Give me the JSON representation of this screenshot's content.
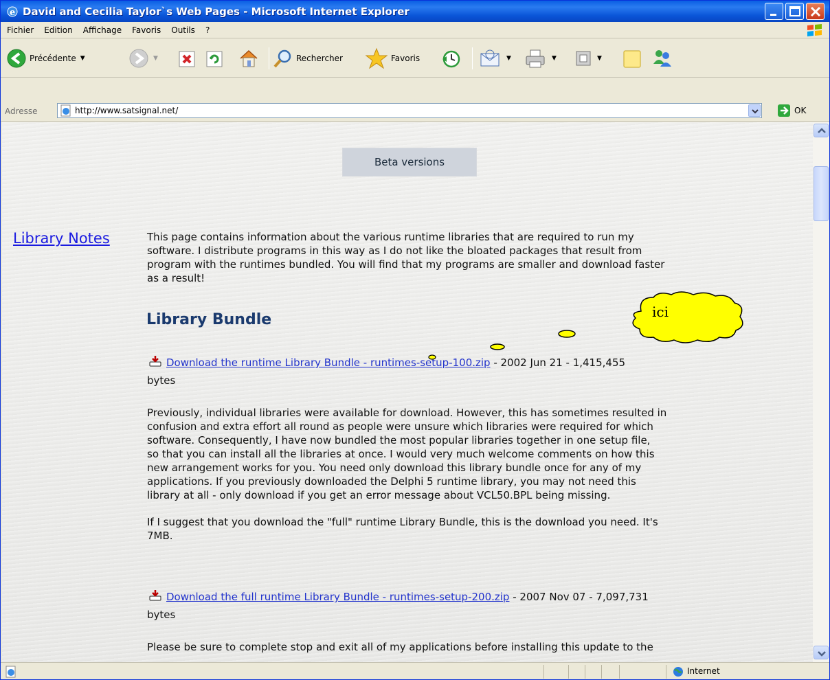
{
  "window": {
    "title": "David and Cecilia Taylor`s Web Pages - Microsoft Internet Explorer"
  },
  "menu": {
    "items": [
      "Fichier",
      "Edition",
      "Affichage",
      "Favoris",
      "Outils",
      "?"
    ]
  },
  "toolbar": {
    "back_label": "Précédente",
    "search_label": "Rechercher",
    "favorites_label": "Favoris"
  },
  "address": {
    "label": "Adresse",
    "url": "http://www.satsignal.net/",
    "go_label": "OK"
  },
  "page": {
    "beta_button": "Beta versions",
    "side_link": "Library Notes",
    "intro_lines": [
      "This page contains information about the various runtime libraries that are required to run my",
      "software.  I distribute programs in this way as I do not like the bloated packages that result from",
      "program with the runtimes bundled.  You will find that my programs are smaller and download faster",
      "as a result!"
    ],
    "heading": "Library Bundle",
    "download1": {
      "link": "Download the runtime Library Bundle - runtimes-setup-100.zip",
      "info": " - 2002 Jun 21 - 1,415,455",
      "tail": "bytes"
    },
    "para2_lines": [
      "Previously, individual libraries were available for download.  However, this has sometimes resulted in",
      "confusion and extra effort all round as people were unsure which libraries were required for which",
      "software.  Consequently, I have now bundled the most popular libraries together in one setup file,",
      "so that you can install all the libraries at once.  I would very much welcome comments on how this",
      "new arrangement works for you.  You need only download this library bundle once for any of my",
      "applications.  If you previously downloaded the Delphi 5 runtime library, you may not need this",
      "library at all - only download if you get an error message about VCL50.BPL being missing."
    ],
    "para3_lines": [
      "If I suggest that you download the \"full\" runtime Library Bundle, this is the download you need.  It's",
      "7MB."
    ],
    "download2": {
      "link": "Download the full runtime Library Bundle - runtimes-setup-200.zip",
      "info": " - 2007 Nov 07 - 7,097,731",
      "tail": "bytes"
    },
    "para4": "Please be sure to complete stop and exit all of my applications before installing this update to the"
  },
  "callout": {
    "text": "ici"
  },
  "status": {
    "zone": "Internet"
  }
}
